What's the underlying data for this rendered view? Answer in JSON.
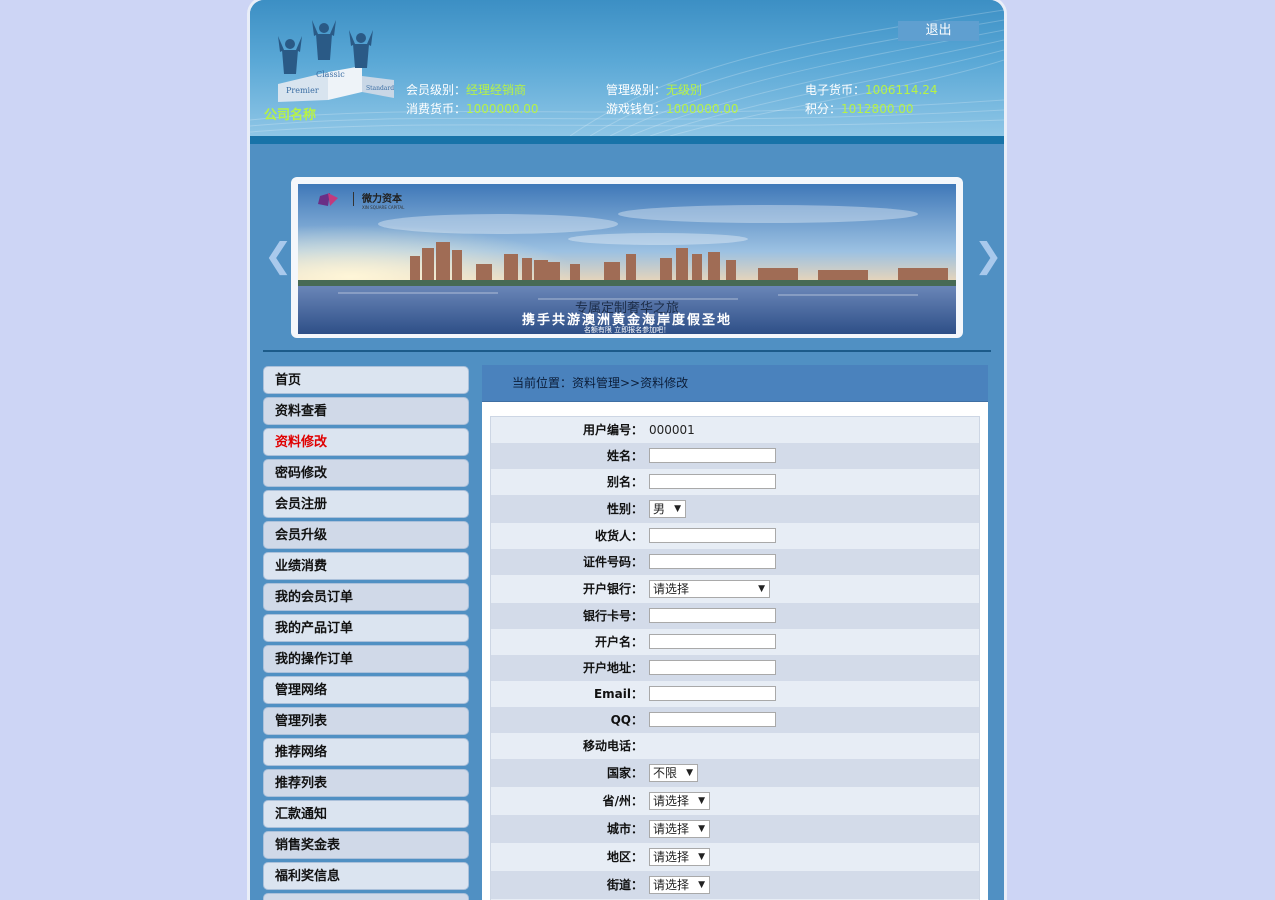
{
  "header": {
    "company_name": "公司名称",
    "logout_label": "退出",
    "logo_words": [
      "Premier",
      "Classic",
      "Standard"
    ],
    "stats": {
      "member_level_label": "会员级别：",
      "member_level_value": "经理经销商",
      "manage_level_label": "管理级别：",
      "manage_level_value": "无级别",
      "ecash_label": "电子货币：",
      "ecash_value": "1006114.24",
      "consume_label": "消费货币：",
      "consume_value": "1000000.00",
      "game_wallet_label": "游戏钱包：",
      "game_wallet_value": "1000000.00",
      "points_label": "积分：",
      "points_value": "1012800.00"
    }
  },
  "banner": {
    "brand_cn": "微力资本",
    "brand_en": "XIN SQUARE CAPITAL",
    "line1": "专属定制奢华之旅",
    "line2": "携手共游澳洲黄金海岸度假圣地",
    "line3": "名额有限 立即报名参加吧！",
    "prev_icon": "chevron-left-icon",
    "next_icon": "chevron-right-icon"
  },
  "sidebar": {
    "items": [
      {
        "label": "首页"
      },
      {
        "label": "资料查看"
      },
      {
        "label": "资料修改",
        "active": true
      },
      {
        "label": "密码修改"
      },
      {
        "label": "会员注册"
      },
      {
        "label": "会员升级"
      },
      {
        "label": "业绩消费"
      },
      {
        "label": "我的会员订单"
      },
      {
        "label": "我的产品订单"
      },
      {
        "label": "我的操作订单"
      },
      {
        "label": "管理网络"
      },
      {
        "label": "管理列表"
      },
      {
        "label": "推荐网络"
      },
      {
        "label": "推荐列表"
      },
      {
        "label": "汇款通知"
      },
      {
        "label": "销售奖金表"
      },
      {
        "label": "福利奖信息"
      }
    ]
  },
  "main": {
    "breadcrumb": "当前位置：资料管理>>资料修改",
    "form": {
      "user_id_label": "用户编号：",
      "user_id_value": "000001",
      "name_label": "姓名：",
      "name_value": "",
      "alias_label": "别名：",
      "alias_value": "",
      "gender_label": "性别：",
      "gender_value": "男",
      "receiver_label": "收货人：",
      "receiver_value": "",
      "id_no_label": "证件号码：",
      "id_no_value": "",
      "bank_label": "开户银行：",
      "bank_value": "请选择",
      "card_label": "银行卡号：",
      "card_value": "",
      "account_name_label": "开户名：",
      "account_name_value": "",
      "bank_addr_label": "开户地址：",
      "bank_addr_value": "",
      "email_label": "Email：",
      "email_value": "",
      "qq_label": "QQ：",
      "qq_value": "",
      "mobile_label": "移动电话：",
      "country_label": "国家：",
      "country_value": "不限",
      "province_label": "省/州：",
      "province_value": "请选择",
      "city_label": "城市：",
      "city_value": "请选择",
      "district_label": "地区：",
      "district_value": "请选择",
      "street_label": "街道：",
      "street_value": "请选择"
    }
  },
  "colors": {
    "page_bg": "#cdd5f5",
    "frame_blue": "#5090c3",
    "highlight_green": "#b6f247",
    "active_red": "#e00000"
  }
}
